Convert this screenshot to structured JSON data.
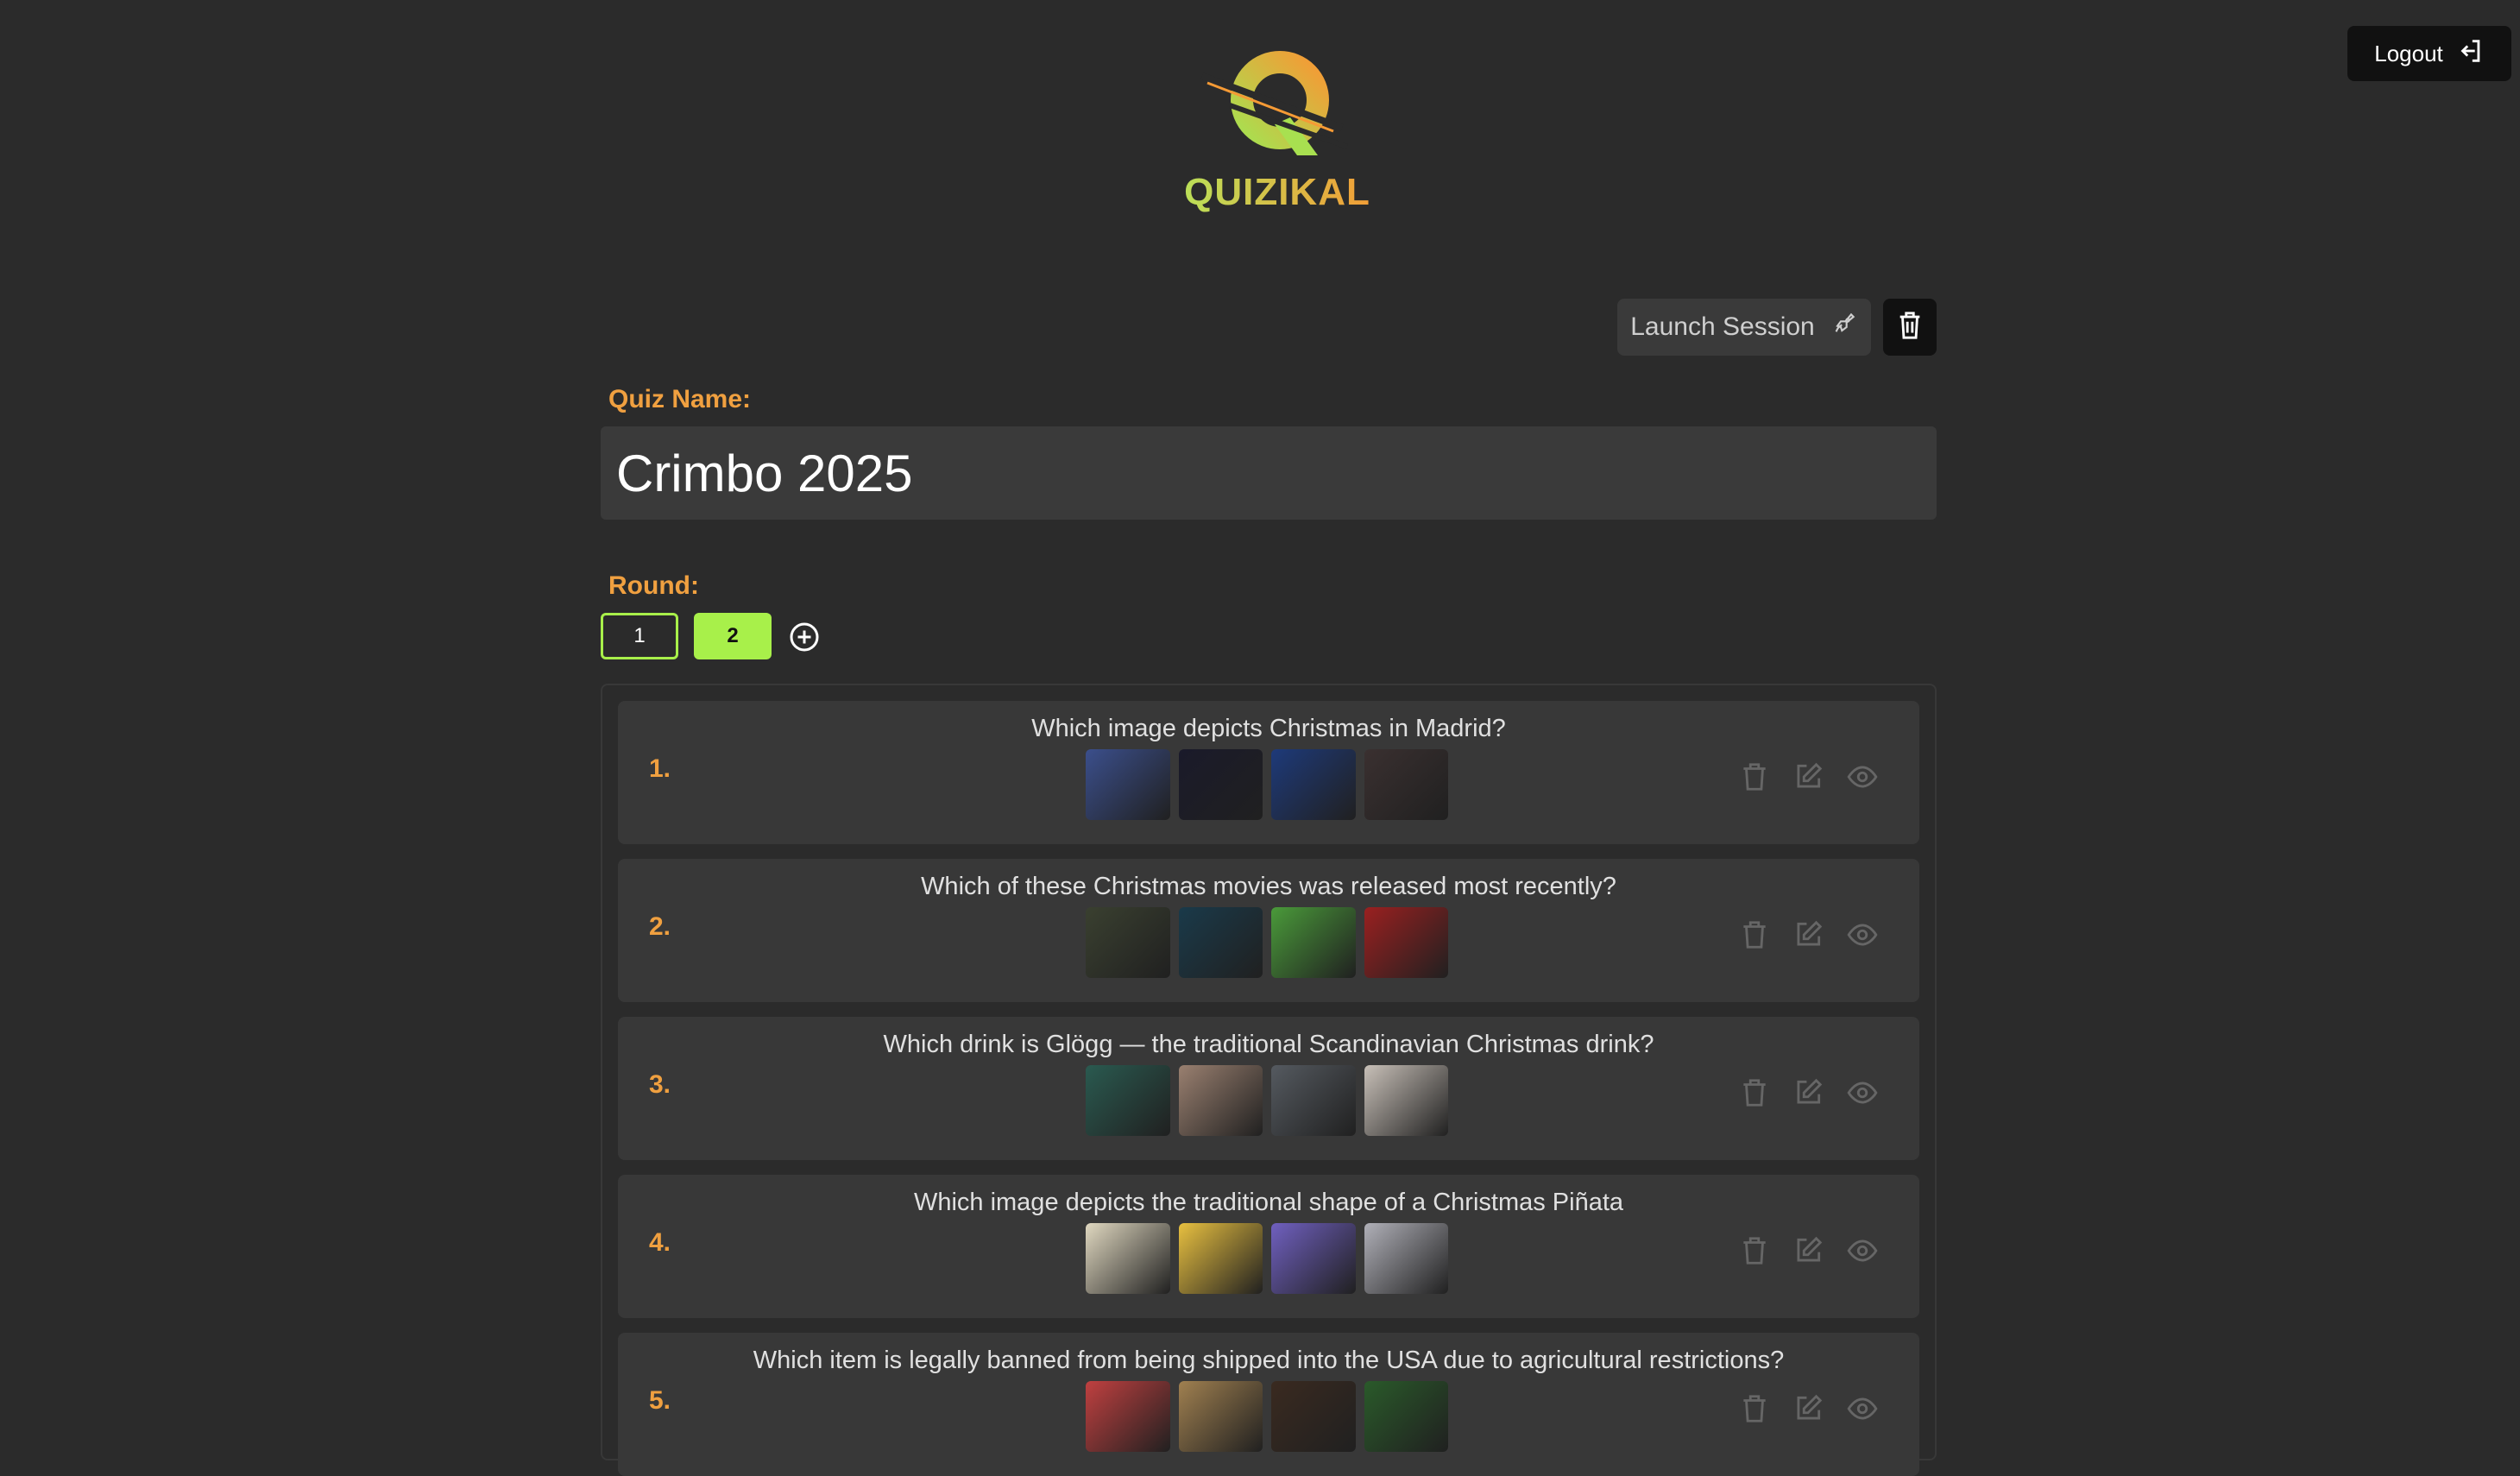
{
  "header": {
    "logout_label": "Logout",
    "brand": "QUIZIKAL"
  },
  "toolbar": {
    "launch_label": "Launch Session"
  },
  "quiz": {
    "name_label": "Quiz Name:",
    "name_value": "Crimbo 2025",
    "round_label": "Round:",
    "rounds": [
      "1",
      "2"
    ],
    "selected_round": "2"
  },
  "questions": [
    {
      "number": "1.",
      "text": "Which image depicts Christmas in Madrid?",
      "thumb_colors": [
        "#3b4f8c",
        "#1a1a2a",
        "#1e3a7a",
        "#3a3030"
      ]
    },
    {
      "number": "2.",
      "text": "Which of these Christmas movies was released most recently?",
      "thumb_colors": [
        "#3a4030",
        "#1a3a4a",
        "#4a9a3a",
        "#9a2020"
      ]
    },
    {
      "number": "3.",
      "text": "Which drink is Glögg — the traditional Scandinavian Christmas drink?",
      "thumb_colors": [
        "#2a5a50",
        "#9a8070",
        "#555a60",
        "#c8c0b8"
      ]
    },
    {
      "number": "4.",
      "text": "Which image depicts the traditional shape of a Christmas Piñata",
      "thumb_colors": [
        "#e0d8c0",
        "#e8c040",
        "#7060c0",
        "#b0b0b8"
      ]
    },
    {
      "number": "5.",
      "text": "Which item is legally banned from being shipped into the USA due to agricultural restrictions?",
      "thumb_colors": [
        "#c04040",
        "#a08050",
        "#3a2a20",
        "#2a5a2a"
      ]
    }
  ],
  "colors": {
    "accent_green": "#a8f04a",
    "accent_orange": "#f0a040",
    "background": "#2b2b2b",
    "card": "#383838"
  }
}
